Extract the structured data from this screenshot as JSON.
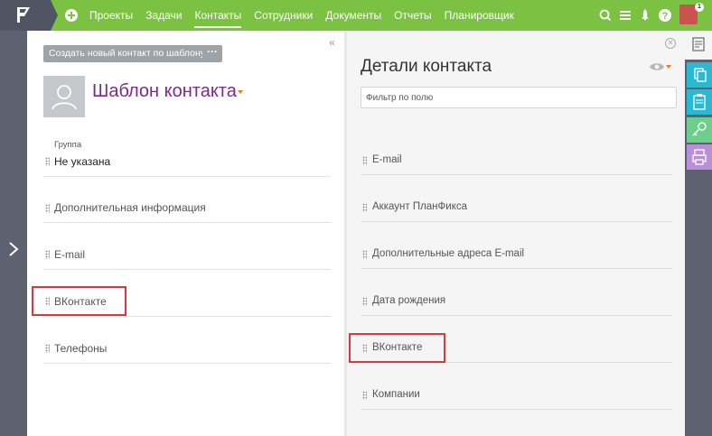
{
  "topbar": {
    "nav": [
      {
        "label": "Проекты"
      },
      {
        "label": "Задачи"
      },
      {
        "label": "Контакты"
      },
      {
        "label": "Сотрудники"
      },
      {
        "label": "Документы"
      },
      {
        "label": "Отчеты"
      },
      {
        "label": "Планировщик"
      }
    ],
    "active_nav": "Контакты",
    "notification_count": "1"
  },
  "left_panel": {
    "template_button": "Создать новый контакт по шаблону",
    "more_button": "···",
    "collapse_icon": "«",
    "title": "Шаблон контакта",
    "group": {
      "label": "Группа",
      "value": "Не указана"
    },
    "fields": [
      {
        "name": "Дополнительная информация"
      },
      {
        "name": "E-mail"
      },
      {
        "name": "ВКонтакте",
        "highlighted": true
      },
      {
        "name": "Телефоны"
      }
    ]
  },
  "right_panel": {
    "title": "Детали контакта",
    "close_icon": "✕",
    "filter_placeholder": "Фильтр по полю",
    "fields": [
      {
        "name": "E-mail"
      },
      {
        "name": "Аккаунт ПланФикса"
      },
      {
        "name": "Дополнительные адреса E-mail"
      },
      {
        "name": "Дата рождения"
      },
      {
        "name": "ВКонтакте",
        "highlighted": true
      },
      {
        "name": "Компании"
      }
    ]
  },
  "colors": {
    "topbar": "#7cc242",
    "sidebar": "#5d6170",
    "title_purple": "#7a2a8c",
    "highlight": "#d8383f",
    "side_teal": "#29b9d3",
    "side_green": "#6ccf8c",
    "side_purple": "#b98fd8"
  }
}
